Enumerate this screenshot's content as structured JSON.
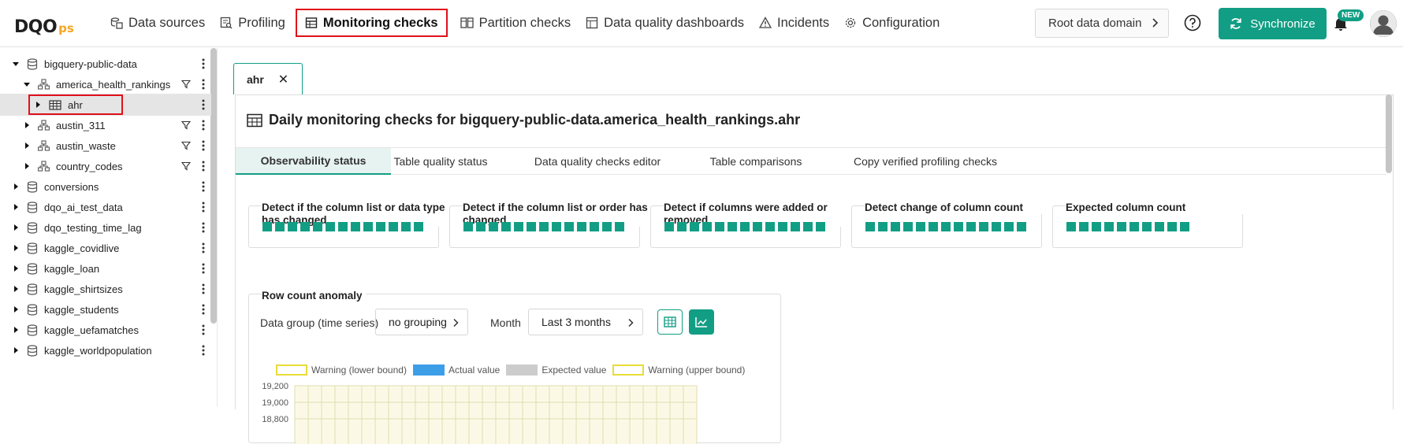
{
  "brand": {
    "logo_main": "DQO",
    "logo_suffix": "ps"
  },
  "nav": {
    "items": [
      {
        "label": "Data sources",
        "icon": "data-sources-icon"
      },
      {
        "label": "Profiling",
        "icon": "profiling-icon"
      },
      {
        "label": "Monitoring checks",
        "icon": "table-icon",
        "active": true
      },
      {
        "label": "Partition checks",
        "icon": "partition-icon"
      },
      {
        "label": "Data quality dashboards",
        "icon": "dashboard-icon"
      },
      {
        "label": "Incidents",
        "icon": "warning-icon"
      },
      {
        "label": "Configuration",
        "icon": "gear-icon"
      }
    ],
    "root_domain": "Root data domain",
    "sync_label": "Synchronize",
    "new_badge": "NEW"
  },
  "tree": [
    {
      "label": "bigquery-public-data",
      "level": 0,
      "type": "database",
      "expanded": true
    },
    {
      "label": "america_health_rankings",
      "level": 1,
      "type": "schema",
      "expanded": true
    },
    {
      "label": "ahr",
      "level": 2,
      "type": "table",
      "selected": true
    },
    {
      "label": "austin_311",
      "level": 1,
      "type": "schema"
    },
    {
      "label": "austin_waste",
      "level": 1,
      "type": "schema"
    },
    {
      "label": "country_codes",
      "level": 1,
      "type": "schema"
    },
    {
      "label": "conversions",
      "level": 0,
      "type": "database"
    },
    {
      "label": "dqo_ai_test_data",
      "level": 0,
      "type": "database"
    },
    {
      "label": "dqo_testing_time_lag",
      "level": 0,
      "type": "database"
    },
    {
      "label": "kaggle_covidlive",
      "level": 0,
      "type": "database"
    },
    {
      "label": "kaggle_loan",
      "level": 0,
      "type": "database"
    },
    {
      "label": "kaggle_shirtsizes",
      "level": 0,
      "type": "database"
    },
    {
      "label": "kaggle_students",
      "level": 0,
      "type": "database"
    },
    {
      "label": "kaggle_uefamatches",
      "level": 0,
      "type": "database"
    },
    {
      "label": "kaggle_worldpopulation",
      "level": 0,
      "type": "database"
    }
  ],
  "tab": {
    "label": "ahr",
    "close": "✕"
  },
  "panel": {
    "title": "Daily monitoring checks for bigquery-public-data.america_health_rankings.ahr",
    "subtabs": [
      "Observability status",
      "Table quality status",
      "Data quality checks editor",
      "Table comparisons",
      "Copy verified profiling checks"
    ],
    "cards": [
      {
        "title": "Detect if the column list or data type has changed",
        "count": 13
      },
      {
        "title": "Detect if the column list or order has changed",
        "count": 13
      },
      {
        "title": "Detect if columns were added or removed",
        "count": 13
      },
      {
        "title": "Detect change of column count",
        "count": 13
      },
      {
        "title": "Expected column count",
        "count": 10
      }
    ],
    "row_count": {
      "title": "Row count anomaly",
      "group_label": "Data group (time series)",
      "group_value": "no grouping",
      "month_label": "Month",
      "month_value": "Last 3 months"
    }
  },
  "chart_data": {
    "type": "line",
    "legend": [
      "Warning (lower bound)",
      "Actual value",
      "Expected value",
      "Warning (upper bound)"
    ],
    "y_ticks": [
      "19,200",
      "19,000",
      "18,800"
    ],
    "colors": {
      "warning": "#f0e442",
      "actual": "#3d9ee8",
      "expected": "#cccccc",
      "plot_bg": "#fbf9e6"
    }
  },
  "colors": {
    "accent": "#129e84",
    "highlight": "#e0101a"
  }
}
